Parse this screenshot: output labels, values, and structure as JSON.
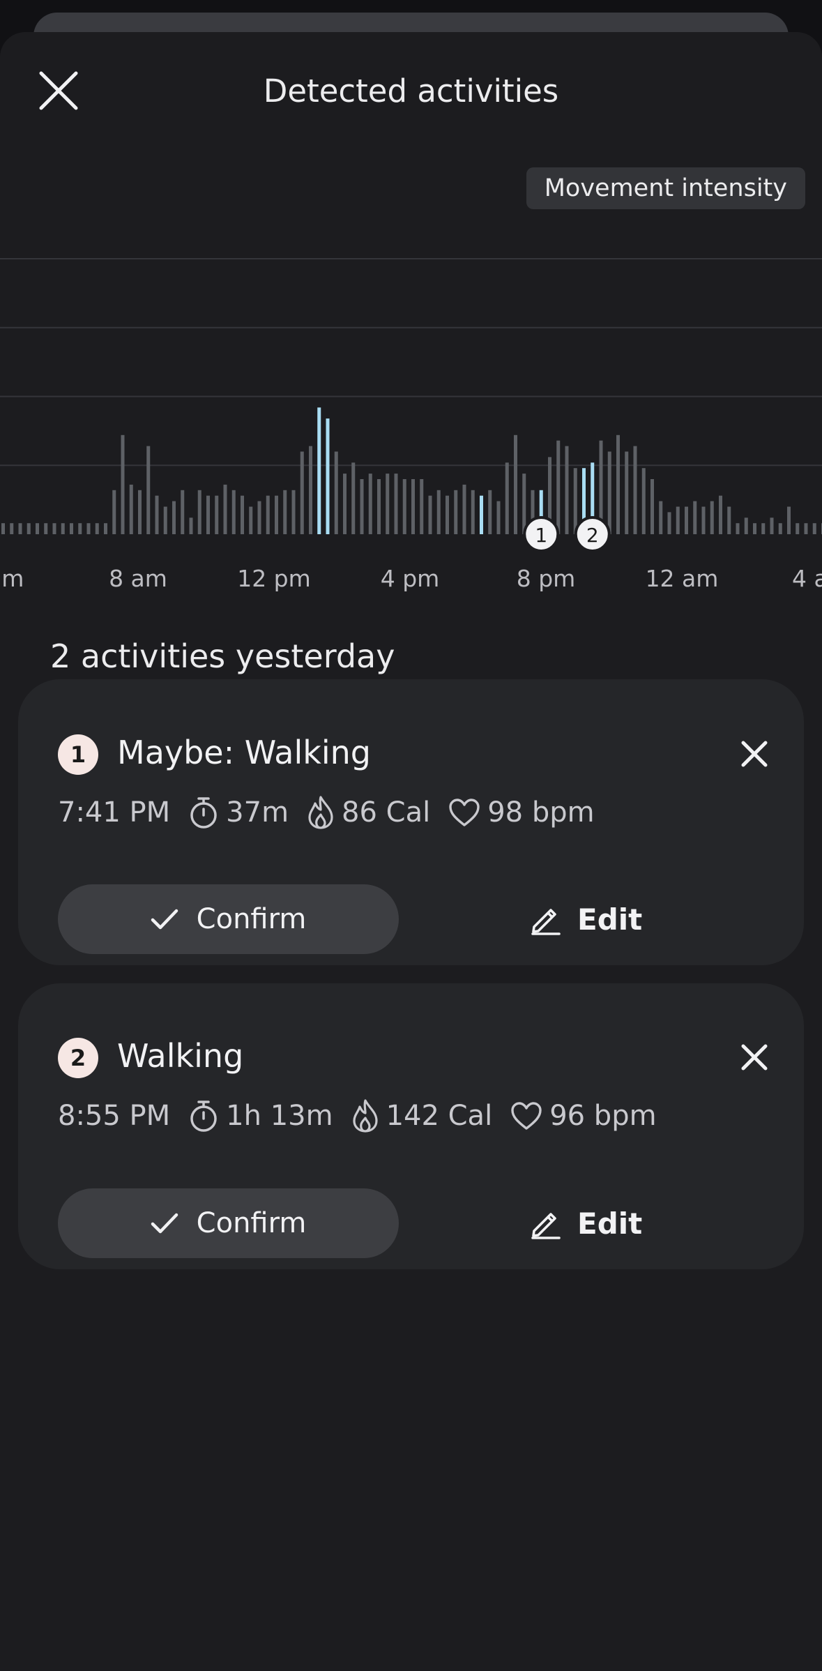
{
  "sheet": {
    "title": "Detected activities"
  },
  "chart_data": {
    "type": "bar",
    "legend_label": "Movement intensity",
    "tick_labels": [
      "am",
      "8 am",
      "12 pm",
      "4 pm",
      "8 pm",
      "12 am",
      "4 a"
    ],
    "ylim": [
      0,
      5
    ],
    "grid": true,
    "values": [
      0.2,
      0.2,
      0.2,
      0.2,
      0.2,
      0.2,
      0.2,
      0.2,
      0.2,
      0.2,
      0.2,
      0.2,
      0.2,
      0.8,
      1.8,
      0.9,
      0.8,
      1.6,
      0.7,
      0.5,
      0.6,
      0.8,
      0.3,
      0.8,
      0.7,
      0.7,
      0.9,
      0.8,
      0.7,
      0.5,
      0.6,
      0.7,
      0.7,
      0.8,
      0.8,
      1.5,
      1.6,
      2.3,
      2.1,
      1.5,
      1.1,
      1.3,
      1.0,
      1.1,
      1.0,
      1.1,
      1.1,
      1.0,
      1.0,
      1.0,
      0.7,
      0.8,
      0.7,
      0.8,
      0.9,
      0.8,
      0.7,
      0.8,
      0.6,
      1.3,
      1.8,
      1.1,
      0.8,
      0.8,
      1.4,
      1.7,
      1.6,
      1.2,
      1.2,
      1.3,
      1.7,
      1.5,
      1.8,
      1.5,
      1.6,
      1.2,
      1.0,
      0.6,
      0.4,
      0.5,
      0.5,
      0.6,
      0.5,
      0.6,
      0.7,
      0.5,
      0.2,
      0.3,
      0.2,
      0.2,
      0.3,
      0.2,
      0.5,
      0.2,
      0.2,
      0.2,
      0.2,
      0.8,
      0.3,
      0.2,
      0.2,
      0.2,
      0.2,
      0.5,
      0.2,
      0.2,
      0.3
    ],
    "highlight_indices": [
      37,
      38,
      56,
      63,
      68,
      69
    ],
    "highlight_color": "#A9DDF3",
    "bar_color": "#5E6166",
    "markers": [
      {
        "label": "1",
        "index": 63
      },
      {
        "label": "2",
        "index": 69
      }
    ]
  },
  "summary_text": "2 activities yesterday",
  "activities": [
    {
      "number": "1",
      "title": "Maybe: Walking",
      "time": "7:41 PM",
      "duration": "37m",
      "calories": "86 Cal",
      "heart_rate": "98 bpm",
      "confirm_label": "Confirm",
      "edit_label": "Edit"
    },
    {
      "number": "2",
      "title": "Walking",
      "time": "8:55 PM",
      "duration": "1h 13m",
      "calories": "142 Cal",
      "heart_rate": "96 bpm",
      "confirm_label": "Confirm",
      "edit_label": "Edit"
    }
  ],
  "icons": {
    "close": "close-icon",
    "dismiss": "x-icon",
    "timer": "stopwatch-icon",
    "calories": "flame-icon",
    "heart": "heart-icon",
    "confirm": "checkmark-icon",
    "edit": "pencil-icon"
  }
}
